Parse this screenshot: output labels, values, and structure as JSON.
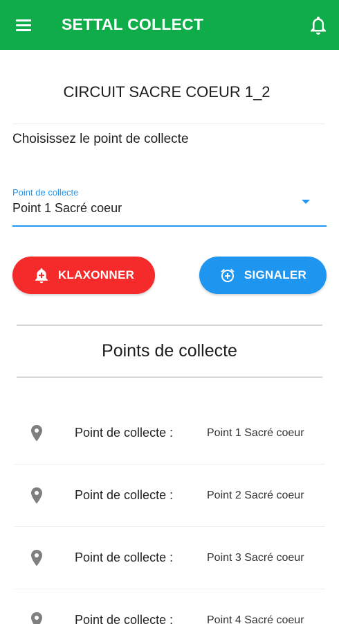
{
  "app": {
    "title": "SETTAL COLLECT",
    "brand_color": "#0fac4a",
    "menu_icon": "hamburger-menu-icon",
    "notification_icon": "bell-icon"
  },
  "circuit": {
    "title": "CIRCUIT SACRE COEUR 1_2"
  },
  "selection": {
    "instruction": "Choisissez le point de collecte",
    "field_label": "Point de collecte",
    "selected_value": "Point 1 Sacré coeur",
    "accent_color": "#2196f3"
  },
  "actions": {
    "klaxonner": {
      "label": "KLAXONNER",
      "icon": "bell-plus-icon",
      "color": "#f52a2a"
    },
    "signaler": {
      "label": "SIGNALER",
      "icon": "alarm-plus-icon",
      "color": "#1e96f0"
    }
  },
  "points_section": {
    "title": "Points de collecte",
    "items": [
      {
        "label": "Point de collecte :",
        "value": "Point 1 Sacré coeur",
        "icon": "location-pin-icon"
      },
      {
        "label": "Point de collecte :",
        "value": "Point 2 Sacré coeur",
        "icon": "location-pin-icon"
      },
      {
        "label": "Point de collecte :",
        "value": "Point 3 Sacré coeur",
        "icon": "location-pin-icon"
      },
      {
        "label": "Point de collecte :",
        "value": "Point 4 Sacré coeur",
        "icon": "location-pin-icon"
      }
    ]
  }
}
